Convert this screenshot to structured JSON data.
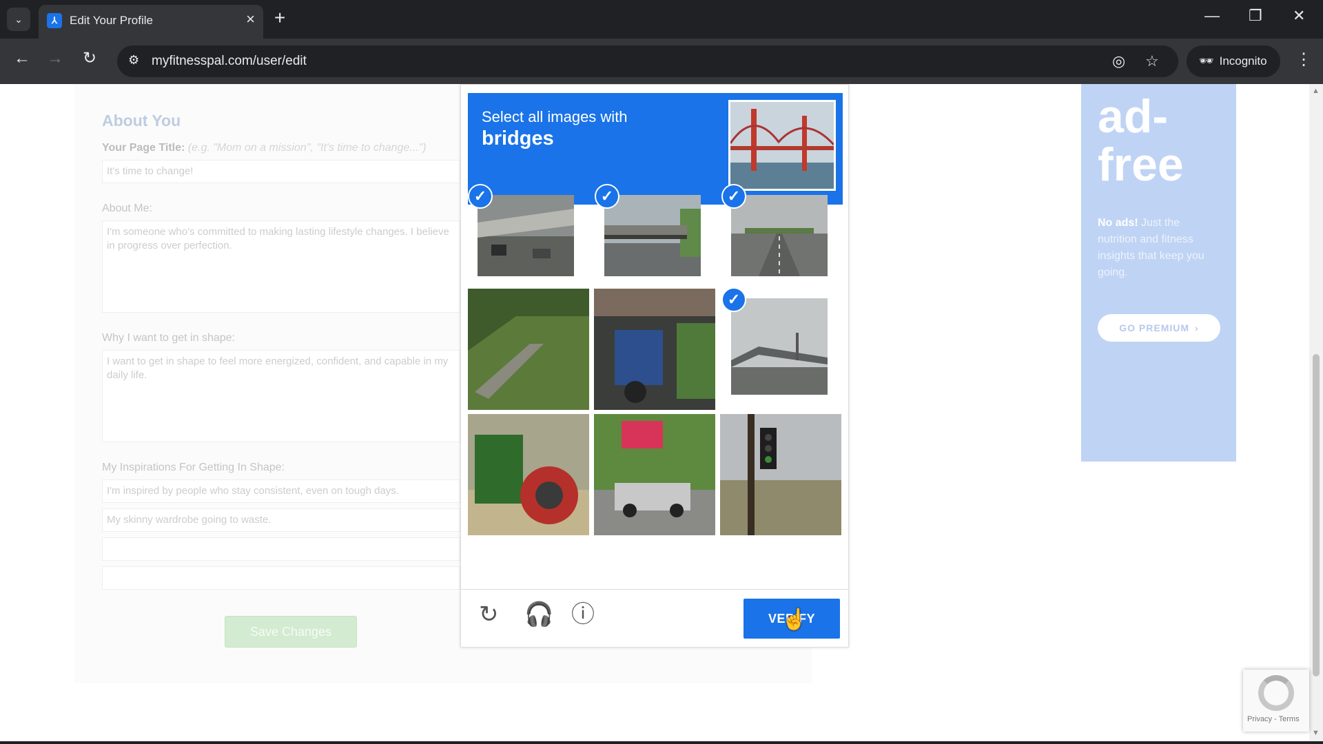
{
  "browser": {
    "tab_title": "Edit Your Profile",
    "url": "myfitnesspal.com/user/edit",
    "incognito_label": "Incognito"
  },
  "form": {
    "section_title": "About You",
    "page_title_label": "Your Page Title:",
    "page_title_hint": "(e.g. \"Mom on a mission\", \"It's time to change...\")",
    "page_title_value": "It's time to change!",
    "about_me_label": "About Me:",
    "about_me_value": "I'm someone who's committed to making lasting lifestyle changes. I believe in progress over perfection.",
    "why_label": "Why I want to get in shape:",
    "why_value": "I want to get in shape to feel more energized, confident, and capable in my daily life.",
    "inspirations_label": "My Inspirations For Getting In Shape:",
    "inspiration_1": "I'm inspired by people who stay consistent, even on tough days.",
    "inspiration_2": "My skinny wardrobe going to waste.",
    "inspiration_3": "",
    "inspiration_4": "",
    "save_label": "Save Changes"
  },
  "ad": {
    "headline_1": "ad-",
    "headline_2": "free",
    "copy_bold": "No ads!",
    "copy_rest": " Just the nutrition and fitness insights that keep you going.",
    "button_label": "GO PREMIUM",
    "button_chevron": "›"
  },
  "captcha": {
    "instruction_line1": "Select all images with",
    "instruction_target": "bridges",
    "verify_label": "VERIFY",
    "tiles": [
      {
        "label": "overpass with cars",
        "selected": true
      },
      {
        "label": "highway overpass",
        "selected": true
      },
      {
        "label": "road overpass",
        "selected": true
      },
      {
        "label": "grassy steps",
        "selected": false
      },
      {
        "label": "storefront",
        "selected": false
      },
      {
        "label": "bridge over road",
        "selected": true
      },
      {
        "label": "tractor",
        "selected": false
      },
      {
        "label": "parking lot",
        "selected": false
      },
      {
        "label": "traffic light",
        "selected": false
      }
    ]
  },
  "recaptcha_badge": {
    "links": "Privacy - Terms"
  },
  "colors": {
    "captcha_blue": "#1a73e8",
    "ad_blue": "#7ea6e8",
    "save_green": "#a6d6a0",
    "section_title": "#7b9ac0"
  }
}
